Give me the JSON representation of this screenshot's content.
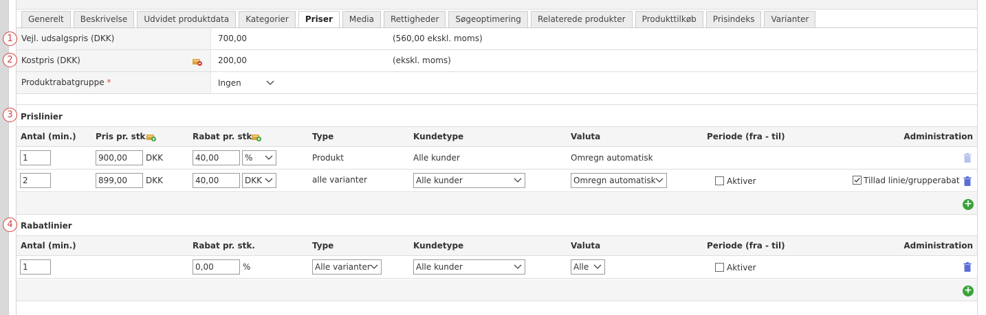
{
  "tabs": [
    "Generelt",
    "Beskrivelse",
    "Udvidet produktdata",
    "Kategorier",
    "Priser",
    "Media",
    "Rettigheder",
    "Søgeoptimering",
    "Relaterede produkter",
    "Produkttilkøb",
    "Prisindeks",
    "Varianter"
  ],
  "active_tab": "Priser",
  "badges": [
    "1",
    "2",
    "3",
    "4"
  ],
  "fields": {
    "retail_label": "Vejl. udsalgspris (DKK)",
    "retail_value": "700,00",
    "retail_ex": "(560,00 ekskl. moms)",
    "cost_label": "Kostpris (DKK)",
    "cost_value": "200,00",
    "cost_ex": "(ekskl. moms)",
    "discount_group_label": "Produktrabatgruppe",
    "required_mark": "*",
    "discount_group_value": "Ingen"
  },
  "price_lines": {
    "title": "Prislinier",
    "headers": {
      "qty": "Antal (min.)",
      "price": "Pris pr. stk.",
      "discount": "Rabat pr. stk.",
      "type": "Type",
      "customer": "Kundetype",
      "currency": "Valuta",
      "period": "Periode (fra - til)",
      "admin": "Administration"
    },
    "rows": [
      {
        "qty": "1",
        "price": "900,00",
        "price_cur": "DKK",
        "discount": "40,00",
        "discount_unit": "%",
        "type": "Produkt",
        "customer": "Alle kunder",
        "currency": "Omregn automatisk"
      },
      {
        "qty": "2",
        "price": "899,00",
        "price_cur": "DKK",
        "discount": "40,00",
        "discount_unit": "DKK",
        "type": "alle varianter",
        "customer": "Alle kunder",
        "currency": "Omregn automatisk",
        "period_label": "Aktiver",
        "allow_label": "Tillad linie/grupperabat"
      }
    ]
  },
  "discount_lines": {
    "title": "Rabatlinier",
    "headers": {
      "qty": "Antal (min.)",
      "discount": "Rabat pr. stk.",
      "type": "Type",
      "customer": "Kundetype",
      "currency": "Valuta",
      "period": "Periode (fra - til)",
      "admin": "Administration"
    },
    "rows": [
      {
        "qty": "1",
        "discount": "0,00",
        "unit": "%",
        "type": "Alle varianter",
        "customer": "Alle kunder",
        "currency": "Alle",
        "period_label": "Aktiver"
      }
    ]
  },
  "colors": {
    "badge": "#d43f3a",
    "add": "#3aa33a",
    "trash": "#5b6fd6",
    "required": "#d9534f"
  }
}
